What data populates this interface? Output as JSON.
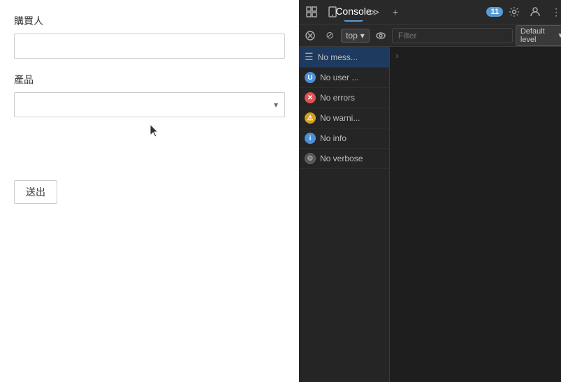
{
  "mainPanel": {
    "buyerLabel": "購買人",
    "productLabel": "產品",
    "submitLabel": "送出",
    "buyerPlaceholder": "",
    "productPlaceholder": ""
  },
  "devtools": {
    "tabs": [
      {
        "label": "◻",
        "id": "elements"
      },
      {
        "label": "⬡",
        "id": "network"
      },
      {
        "label": "Console",
        "id": "console",
        "active": true
      },
      {
        "label": "≫",
        "id": "more"
      },
      {
        "label": "+",
        "id": "add"
      }
    ],
    "badge": "11",
    "toolbar2": {
      "prohibitIcon": "⊘",
      "topSelector": "top",
      "eyeIcon": "👁",
      "filterPlaceholder": "Filter",
      "defaultLevel": "Default level",
      "settingsIcon": "⚙"
    },
    "sidebar": {
      "items": [
        {
          "id": "all",
          "iconType": "list",
          "label": "No mess..."
        },
        {
          "id": "user",
          "iconType": "blue-circle",
          "label": "No user ..."
        },
        {
          "id": "errors",
          "iconType": "red-circle",
          "label": "No errors"
        },
        {
          "id": "warnings",
          "iconType": "yellow-circle",
          "label": "No warni..."
        },
        {
          "id": "info",
          "iconType": "info-circle",
          "label": "No info"
        },
        {
          "id": "verbose",
          "iconType": "verbose-circle",
          "label": "No verbose"
        }
      ]
    }
  }
}
